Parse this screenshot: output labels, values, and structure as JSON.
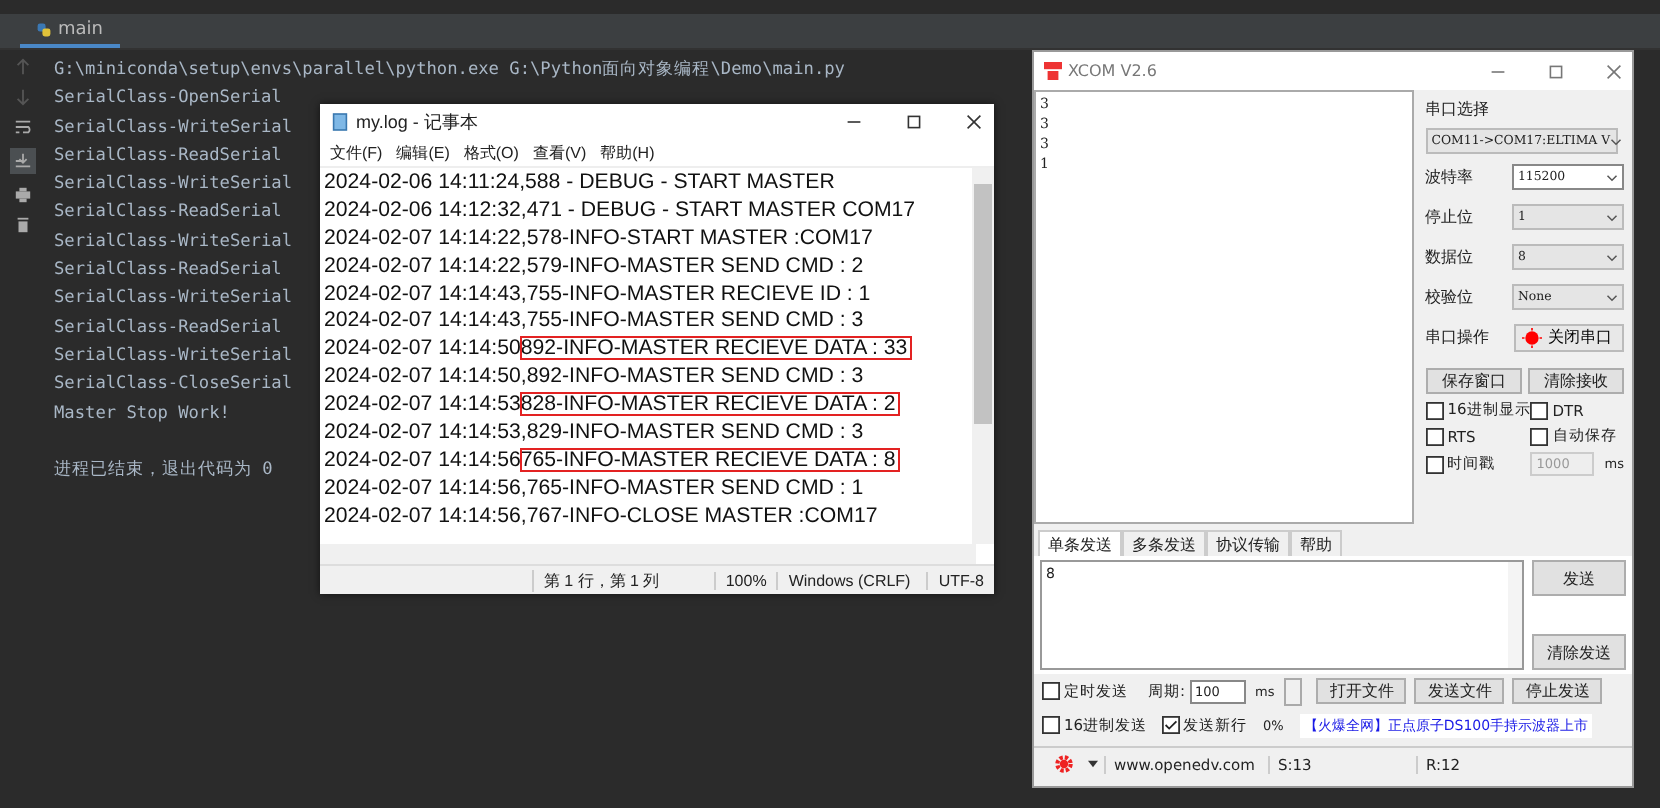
{
  "ide": {
    "tab": "main",
    "lines": [
      "G:\\miniconda\\setup\\envs\\parallel\\python.exe G:\\Python面向对象编程\\Demo\\main.py",
      "SerialClass-OpenSerial",
      "SerialClass-WriteSerial",
      "SerialClass-ReadSerial",
      "SerialClass-WriteSerial",
      "SerialClass-ReadSerial",
      "SerialClass-WriteSerial",
      "SerialClass-ReadSerial",
      "SerialClass-WriteSerial",
      "SerialClass-ReadSerial",
      "SerialClass-WriteSerial",
      "SerialClass-CloseSerial",
      "Master Stop Work!"
    ],
    "exit": "进程已结束，退出代码为 0"
  },
  "notepad": {
    "title": "my.log - 记事本",
    "menu": [
      "文件(F)",
      "编辑(E)",
      "格式(O)",
      "查看(V)",
      "帮助(H)"
    ],
    "lines": [
      {
        "text": "2024-02-06 14:11:24,588 - DEBUG - START MASTER"
      },
      {
        "text": "2024-02-06 14:12:32,471 - DEBUG - START MASTER COM17"
      },
      {
        "text": "2024-02-07 14:14:22,578-INFO-START MASTER :COM17"
      },
      {
        "text": "2024-02-07 14:14:22,579-INFO-MASTER SEND CMD : 2"
      },
      {
        "text": "2024-02-07 14:14:43,755-INFO-MASTER RECIEVE ID : 1"
      },
      {
        "text": "2024-02-07 14:14:43,755-INFO-MASTER SEND CMD : 3"
      },
      {
        "text": "2024-02-07 14:14:50",
        "boxed": "892-INFO-MASTER RECIEVE DATA : 33"
      },
      {
        "text": "2024-02-07 14:14:50,892-INFO-MASTER SEND CMD : 3"
      },
      {
        "text": "2024-02-07 14:14:53",
        "boxed": "828-INFO-MASTER RECIEVE DATA : 2"
      },
      {
        "text": "2024-02-07 14:14:53,829-INFO-MASTER SEND CMD : 3"
      },
      {
        "text": "2024-02-07 14:14:56",
        "boxed": "765-INFO-MASTER RECIEVE DATA : 8"
      },
      {
        "text": "2024-02-07 14:14:56,765-INFO-MASTER SEND CMD : 1"
      },
      {
        "text": "2024-02-07 14:14:56,767-INFO-CLOSE MASTER :COM17"
      }
    ],
    "status": [
      "第 1 行，第 1 列",
      "100%",
      "Windows (CRLF)",
      "UTF-8"
    ]
  },
  "xcom": {
    "title": "XCOM V2.6",
    "received": [
      "3",
      "3",
      "3",
      "1"
    ],
    "port_label": "串口选择",
    "port": "COM11->COM17:ELTIMA V",
    "settings": [
      {
        "label": "波特率",
        "value": "115200"
      },
      {
        "label": "停止位",
        "value": "1"
      },
      {
        "label": "数据位",
        "value": "8"
      },
      {
        "label": "校验位",
        "value": "None"
      }
    ],
    "op_label": "串口操作",
    "open_button": {
      "label": "关闭串口",
      "on": true
    },
    "buttons": [
      "保存窗口",
      "清除接收"
    ],
    "options": [
      {
        "label": "16进制显示",
        "checked": false
      },
      {
        "label": "DTR",
        "checked": false
      },
      {
        "label": "RTS",
        "checked": false
      },
      {
        "label": "自动保存",
        "checked": false
      },
      {
        "label": "时间戳",
        "checked": false
      }
    ],
    "interval": "1000",
    "interval_unit": "ms",
    "tabs": [
      {
        "label": "单条发送",
        "selected": true
      },
      {
        "label": "多条发送",
        "selected": false
      },
      {
        "label": "协议传输",
        "selected": false
      },
      {
        "label": "帮助",
        "selected": false
      }
    ],
    "send_text": "8",
    "send_button": "发送",
    "clear_send_button": "清除发送",
    "timed": {
      "label": "定时发送",
      "checked": false
    },
    "period_label": "周期:",
    "period": "100",
    "period_unit": "ms",
    "file_buttons": [
      "打开文件",
      "发送文件",
      "停止发送"
    ],
    "hex_send": {
      "label": "16进制发送",
      "checked": false
    },
    "newline": {
      "label": "发送新行",
      "checked": true
    },
    "progress": {
      "text": "0%",
      "level": 0
    },
    "ad": "【火爆全网】正点原子DS100手持示波器上市",
    "status": [
      "www.openedv.com",
      "S:13",
      "R:12"
    ]
  }
}
